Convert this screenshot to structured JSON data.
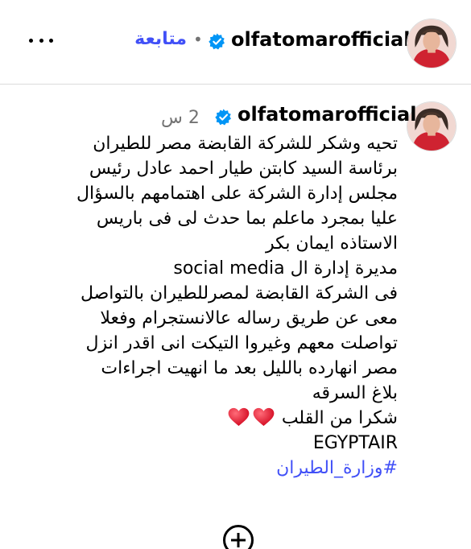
{
  "header": {
    "username": "olfatomarofficial",
    "separator": "•",
    "follow_label": "متابعة",
    "more_icon": "more-horizontal-icon",
    "verified_icon": "verified-badge-icon"
  },
  "post": {
    "username": "olfatomarofficial",
    "time": "2 س",
    "caption_lines": [
      "تحيه وشكر للشركة القابضة مصر للطيران",
      "برئاسة السيد كابتن طيار احمد عادل رئيس",
      "مجلس إدارة الشركة على اهتمامهم بالسؤال",
      "عليا بمجرد ماعلم بما حدث لى فى باريس",
      "الاستاذه ايمان بكر",
      "مديرة إدارة ال social media",
      "فى الشركة القابضة لمصرللطيران بالتواصل",
      "معى عن طريق رساله عالانستجرام وفعلا",
      "تواصلت معهم وغيروا التيكت انى اقدر انزل",
      "مصر انهارده بالليل بعد ما انهيت اجراءات",
      "بلاغ السرقه"
    ],
    "thanks_line": "شكرا من القلب",
    "heart_icons": [
      "heart-icon",
      "heart-icon"
    ],
    "brand_line": "EGYPTAIR",
    "hashtag": "#وزارة_الطيران"
  },
  "actions": {
    "add_comment_icon": "plus-circle-icon"
  },
  "colors": {
    "link_blue": "#4150f7",
    "verified_blue": "#0095f6",
    "muted_gray": "#737373",
    "divider": "#dbdbdb",
    "heart_red": "#e0102a"
  }
}
